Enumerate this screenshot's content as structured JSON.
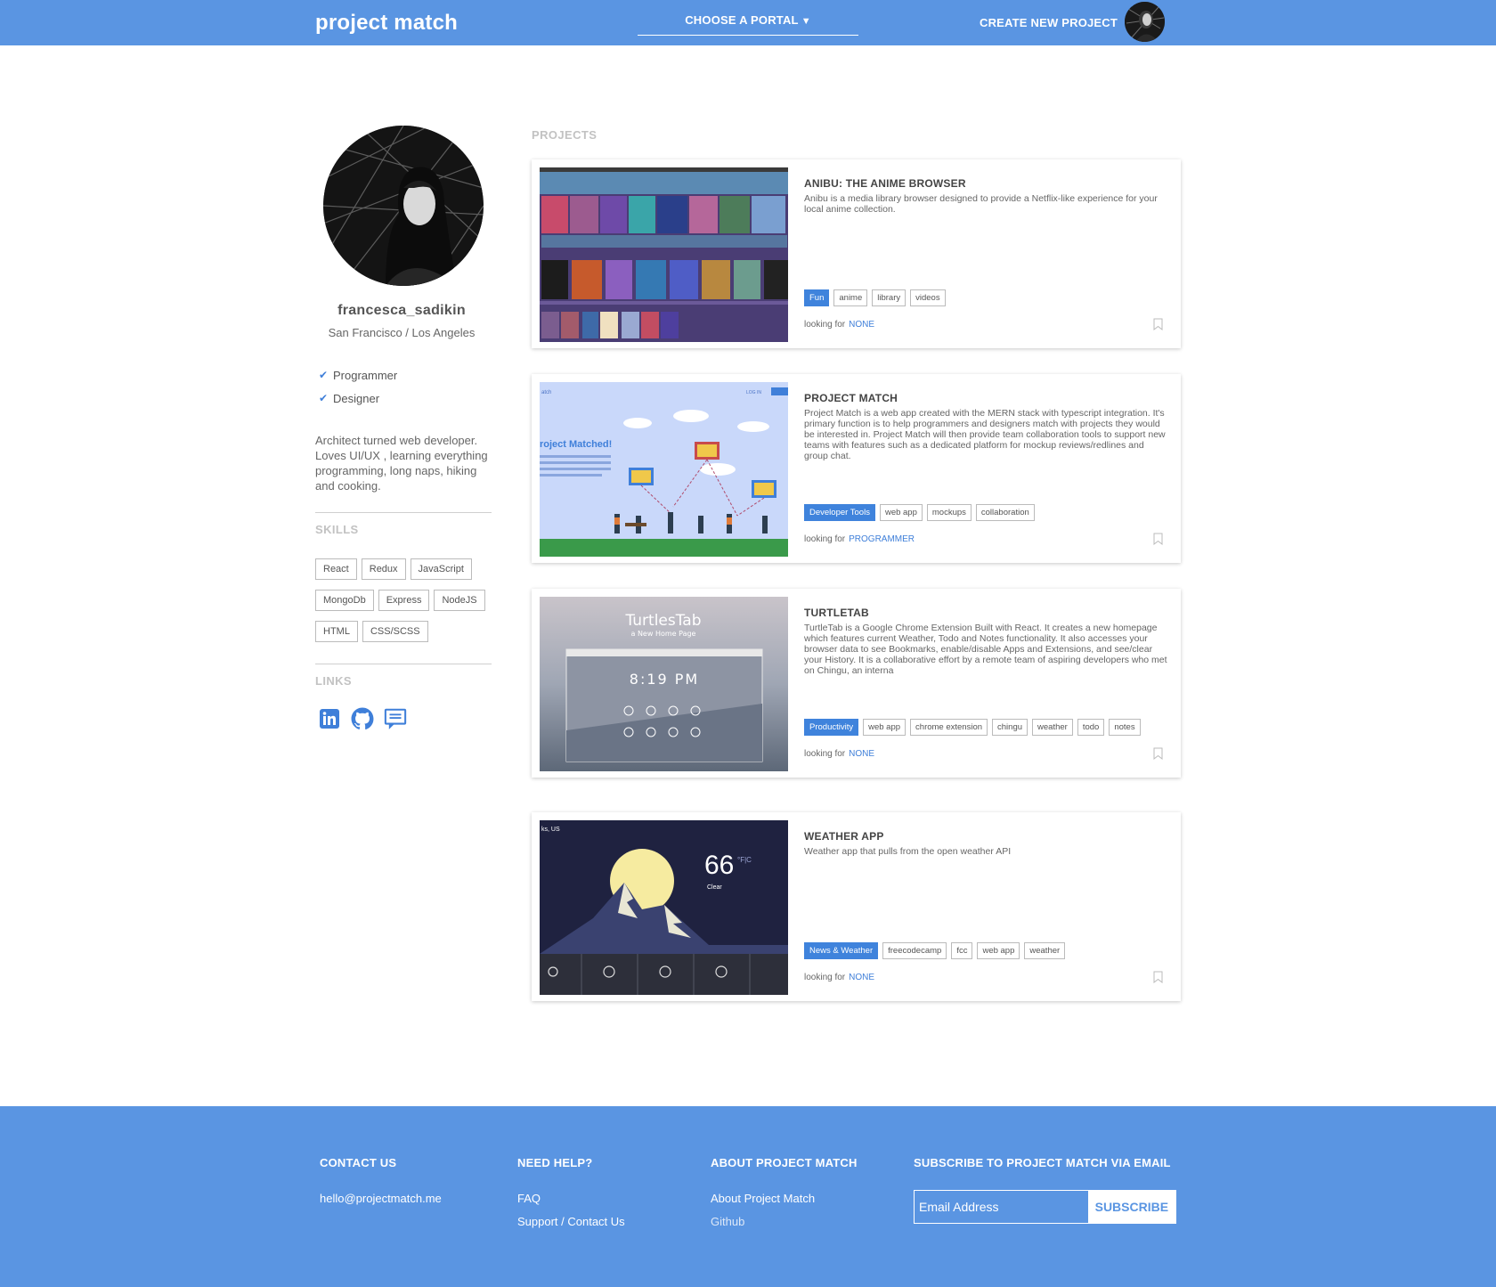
{
  "brand": {
    "name": "project match",
    "primary_color": "#5a95e2",
    "accent_color": "#3f7fd9"
  },
  "nav": {
    "portal_label": "CHOOSE A PORTAL",
    "portal_caret": "▼",
    "create_label": "CREATE NEW PROJECT"
  },
  "profile": {
    "username": "francesca_sadikin",
    "location": "San Francisco / Los Angeles",
    "roles": [
      "Programmer",
      "Designer"
    ],
    "bio": "Architect turned web developer. Loves UI/UX , learning everything programming, long naps, hiking and cooking.",
    "skills_heading": "SKILLS",
    "skills": [
      "React",
      "Redux",
      "JavaScript",
      "MongoDb",
      "Express",
      "NodeJS",
      "HTML",
      "CSS/SCSS"
    ],
    "links_heading": "LINKS",
    "links": [
      "linkedin-icon",
      "github-icon",
      "chat-icon"
    ]
  },
  "projects": {
    "heading": "PROJECTS",
    "looking_for_label": "looking for",
    "items": [
      {
        "title": "ANIBU: THE ANIME BROWSER",
        "description": "Anibu is a media library browser designed to provide a Netflix-like experience for your local anime collection.",
        "tags": [
          "Fun",
          "anime",
          "library",
          "videos"
        ],
        "looking_for": "NONE"
      },
      {
        "title": "PROJECT MATCH",
        "description": "Project Match is a web app created with the MERN stack with typescript integration. It's primary function is to help programmers and designers match with projects they would be interested in. Project Match will then provide team collaboration tools to support new teams with features such as a dedicated platform for mockup reviews/redlines and group chat.",
        "tags": [
          "Developer Tools",
          "web app",
          "mockups",
          "collaboration"
        ],
        "looking_for": "PROGRAMMER",
        "image_text": {
          "heading": "roject Matched!",
          "nav_left": "atch",
          "nav_login": "LOG IN"
        }
      },
      {
        "title": "TURTLETAB",
        "description": "TurtleTab is a Google Chrome Extension Built with React. It creates a new homepage which features current Weather, Todo and Notes functionality. It also accesses your browser data to see Bookmarks, enable/disable Apps and Extensions, and see/clear your History. It is a collaborative effort by a remote team of aspiring developers who met on Chingu, an interna",
        "tags": [
          "Productivity",
          "web app",
          "chrome extension",
          "chingu",
          "weather",
          "todo",
          "notes"
        ],
        "looking_for": "NONE",
        "image_text": {
          "title": "TurtlesTab",
          "subtitle": "a New Home Page",
          "clock": "8:19 PM"
        }
      },
      {
        "title": "WEATHER APP",
        "description": "Weather app that pulls from the open weather API",
        "tags": [
          "News & Weather",
          "freecodecamp",
          "fcc",
          "web app",
          "weather"
        ],
        "looking_for": "NONE",
        "image_text": {
          "location": "ks, US",
          "temp": "66",
          "units": "°F|C",
          "condition": "Clear"
        }
      }
    ]
  },
  "footer": {
    "contact": {
      "heading": "CONTACT US",
      "email": "hello@projectmatch.me"
    },
    "help": {
      "heading": "NEED HELP?",
      "items": [
        "FAQ",
        "Support / Contact Us"
      ]
    },
    "about": {
      "heading": "ABOUT PROJECT MATCH",
      "items": [
        "About Project Match",
        "Github"
      ]
    },
    "subscribe": {
      "heading": "SUBSCRIBE TO PROJECT MATCH VIA EMAIL",
      "placeholder": "Email Address",
      "button": "SUBSCRIBE"
    }
  }
}
